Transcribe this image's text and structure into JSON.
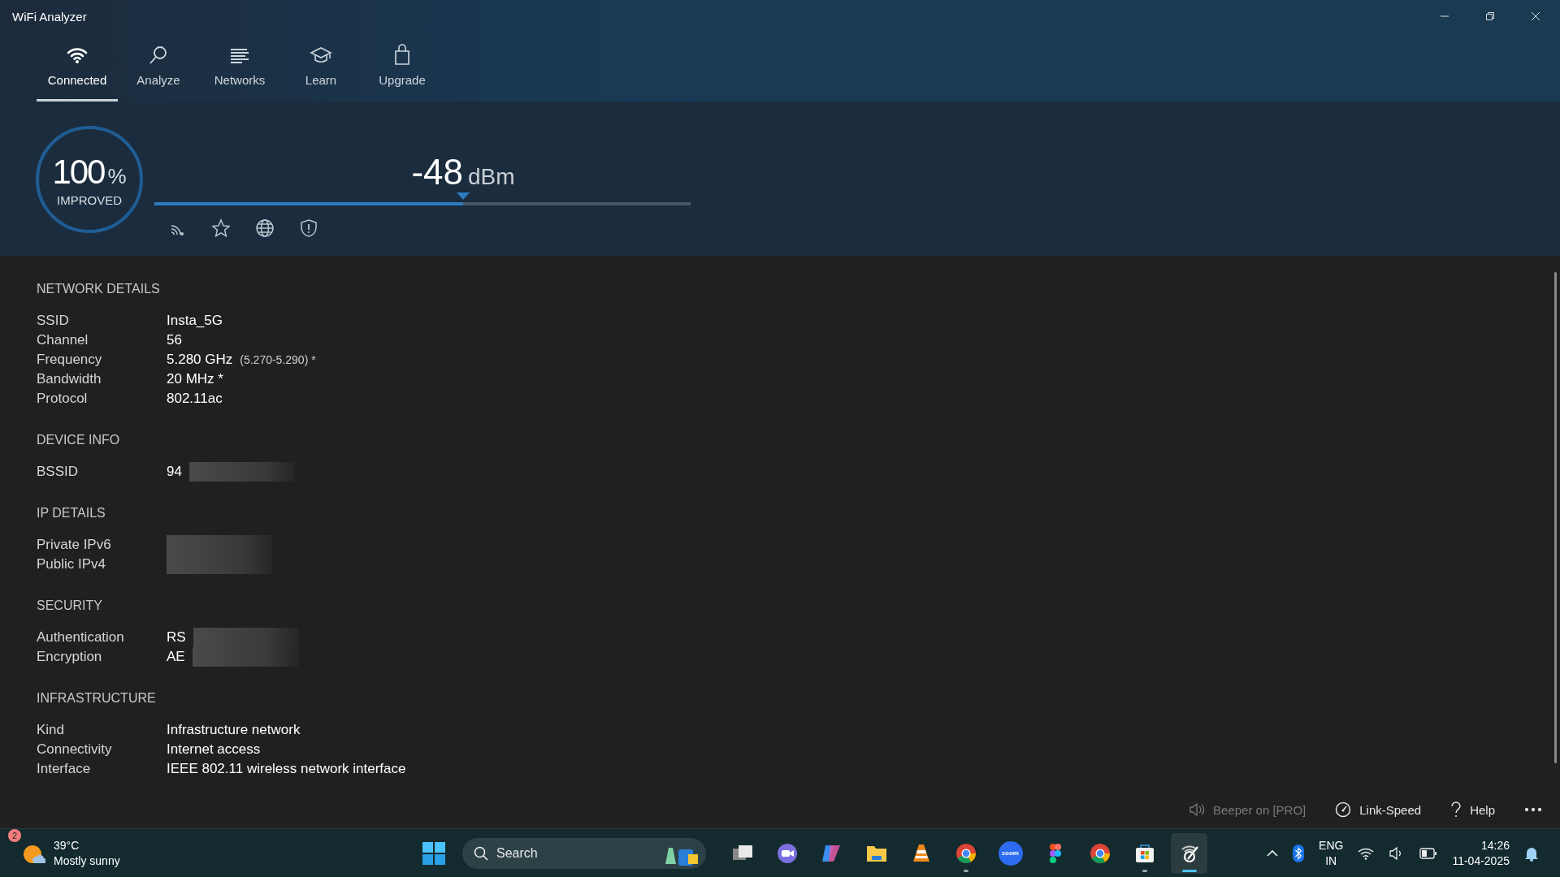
{
  "window": {
    "title": "WiFi Analyzer"
  },
  "tabs": [
    {
      "label": "Connected",
      "kind": "wifi",
      "selected": true
    },
    {
      "label": "Analyze",
      "kind": "magnifier",
      "selected": false
    },
    {
      "label": "Networks",
      "kind": "list",
      "selected": false
    },
    {
      "label": "Learn",
      "kind": "cap",
      "selected": false
    },
    {
      "label": "Upgrade",
      "kind": "bag",
      "selected": false
    }
  ],
  "signal": {
    "percent": "100",
    "percent_unit": "%",
    "status": "IMPROVED",
    "reading": "-48",
    "unit": "dBm",
    "level": 0.575
  },
  "sections": [
    {
      "heading": "NETWORK DETAILS",
      "rows": [
        {
          "label": "SSID",
          "value": "Insta_5G"
        },
        {
          "label": "Channel",
          "value": "56"
        },
        {
          "label": "Frequency",
          "value": "5.280 GHz",
          "note": "(5.270-5.290) *"
        },
        {
          "label": "Bandwidth",
          "value": "20 MHz *"
        },
        {
          "label": "Protocol",
          "value": "802.11ac"
        }
      ]
    },
    {
      "heading": "DEVICE INFO",
      "rows": [
        {
          "label": "BSSID",
          "value": "94",
          "redacted": true
        }
      ]
    },
    {
      "heading": "IP DETAILS",
      "rows": [
        {
          "label": "Private IPv6",
          "redacted": true
        },
        {
          "label": "Public IPv4",
          "redacted": true
        }
      ]
    },
    {
      "heading": "SECURITY",
      "rows": [
        {
          "label": "Authentication",
          "value": "RS",
          "redacted": true
        },
        {
          "label": "Encryption",
          "value": "AE",
          "redacted": true
        }
      ]
    },
    {
      "heading": "INFRASTRUCTURE",
      "rows": [
        {
          "label": "Kind",
          "value": "Infrastructure network"
        },
        {
          "label": "Connectivity",
          "value": "Internet access"
        },
        {
          "label": "Interface",
          "value": "IEEE 802.11 wireless network interface"
        }
      ]
    }
  ],
  "commands": [
    {
      "label": "Beeper on [PRO]",
      "kind": "speaker",
      "disabled": true
    },
    {
      "label": "Link-Speed",
      "kind": "gauge",
      "disabled": false
    },
    {
      "label": "Help",
      "kind": "question",
      "disabled": false
    }
  ],
  "taskbar": {
    "weather": {
      "temp": "39°C",
      "condition": "Mostly sunny",
      "badge": "2"
    },
    "search": {
      "placeholder": "Search"
    },
    "apps": [
      {
        "kind": "taskview",
        "running": false,
        "selected": false
      },
      {
        "kind": "meet",
        "running": false,
        "selected": false
      },
      {
        "kind": "copilot",
        "running": false,
        "selected": false
      },
      {
        "kind": "folder",
        "running": false,
        "selected": false
      },
      {
        "kind": "cone",
        "running": false,
        "selected": false
      },
      {
        "kind": "browser",
        "running": true,
        "selected": false
      },
      {
        "kind": "zoom",
        "label": "zoom",
        "running": false,
        "selected": false
      },
      {
        "kind": "figma",
        "running": false,
        "selected": false
      },
      {
        "kind": "browser",
        "running": false,
        "selected": false
      },
      {
        "kind": "store",
        "running": true,
        "selected": false
      },
      {
        "kind": "analyzer",
        "running": true,
        "selected": true
      }
    ],
    "tray": {
      "language": "ENG",
      "region": "IN",
      "time": "14:26",
      "date": "11-04-2025"
    }
  }
}
